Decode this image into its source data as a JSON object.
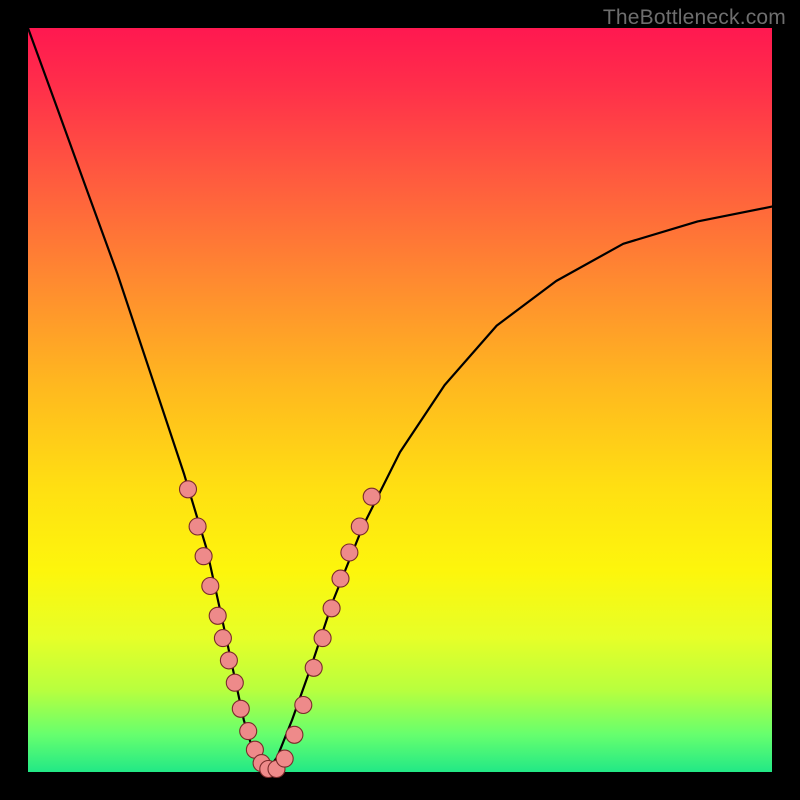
{
  "watermark": "TheBottleneck.com",
  "colors": {
    "dot_fill": "#ee8a8a",
    "dot_stroke": "#7a2b2b",
    "curve": "#000000",
    "frame_bg": "#000000"
  },
  "chart_data": {
    "type": "line",
    "title": "",
    "xlabel": "",
    "ylabel": "",
    "xlim": [
      0,
      1
    ],
    "ylim": [
      0,
      1
    ],
    "grid": false,
    "legend": false,
    "series": [
      {
        "name": "bottleneck-curve",
        "x": [
          0.0,
          0.04,
          0.08,
          0.12,
          0.15,
          0.18,
          0.21,
          0.24,
          0.26,
          0.275,
          0.29,
          0.305,
          0.32,
          0.335,
          0.355,
          0.38,
          0.41,
          0.45,
          0.5,
          0.56,
          0.63,
          0.71,
          0.8,
          0.9,
          1.0
        ],
        "y": [
          1.0,
          0.89,
          0.78,
          0.67,
          0.58,
          0.49,
          0.4,
          0.3,
          0.21,
          0.14,
          0.07,
          0.02,
          0.0,
          0.02,
          0.07,
          0.14,
          0.23,
          0.33,
          0.43,
          0.52,
          0.6,
          0.66,
          0.71,
          0.74,
          0.76
        ]
      }
    ],
    "points": [
      {
        "name": "p1",
        "x": 0.215,
        "y": 0.38
      },
      {
        "name": "p2",
        "x": 0.228,
        "y": 0.33
      },
      {
        "name": "p3",
        "x": 0.236,
        "y": 0.29
      },
      {
        "name": "p4",
        "x": 0.245,
        "y": 0.25
      },
      {
        "name": "p5",
        "x": 0.255,
        "y": 0.21
      },
      {
        "name": "p6",
        "x": 0.262,
        "y": 0.18
      },
      {
        "name": "p7",
        "x": 0.27,
        "y": 0.15
      },
      {
        "name": "p8",
        "x": 0.278,
        "y": 0.12
      },
      {
        "name": "p9",
        "x": 0.286,
        "y": 0.085
      },
      {
        "name": "p10",
        "x": 0.296,
        "y": 0.055
      },
      {
        "name": "p11",
        "x": 0.305,
        "y": 0.03
      },
      {
        "name": "p12",
        "x": 0.314,
        "y": 0.012
      },
      {
        "name": "p13",
        "x": 0.323,
        "y": 0.004
      },
      {
        "name": "p14",
        "x": 0.334,
        "y": 0.004
      },
      {
        "name": "p15",
        "x": 0.345,
        "y": 0.018
      },
      {
        "name": "p16",
        "x": 0.358,
        "y": 0.05
      },
      {
        "name": "p17",
        "x": 0.37,
        "y": 0.09
      },
      {
        "name": "p18",
        "x": 0.384,
        "y": 0.14
      },
      {
        "name": "p19",
        "x": 0.396,
        "y": 0.18
      },
      {
        "name": "p20",
        "x": 0.408,
        "y": 0.22
      },
      {
        "name": "p21",
        "x": 0.42,
        "y": 0.26
      },
      {
        "name": "p22",
        "x": 0.432,
        "y": 0.295
      },
      {
        "name": "p23",
        "x": 0.446,
        "y": 0.33
      },
      {
        "name": "p24",
        "x": 0.462,
        "y": 0.37
      }
    ]
  }
}
